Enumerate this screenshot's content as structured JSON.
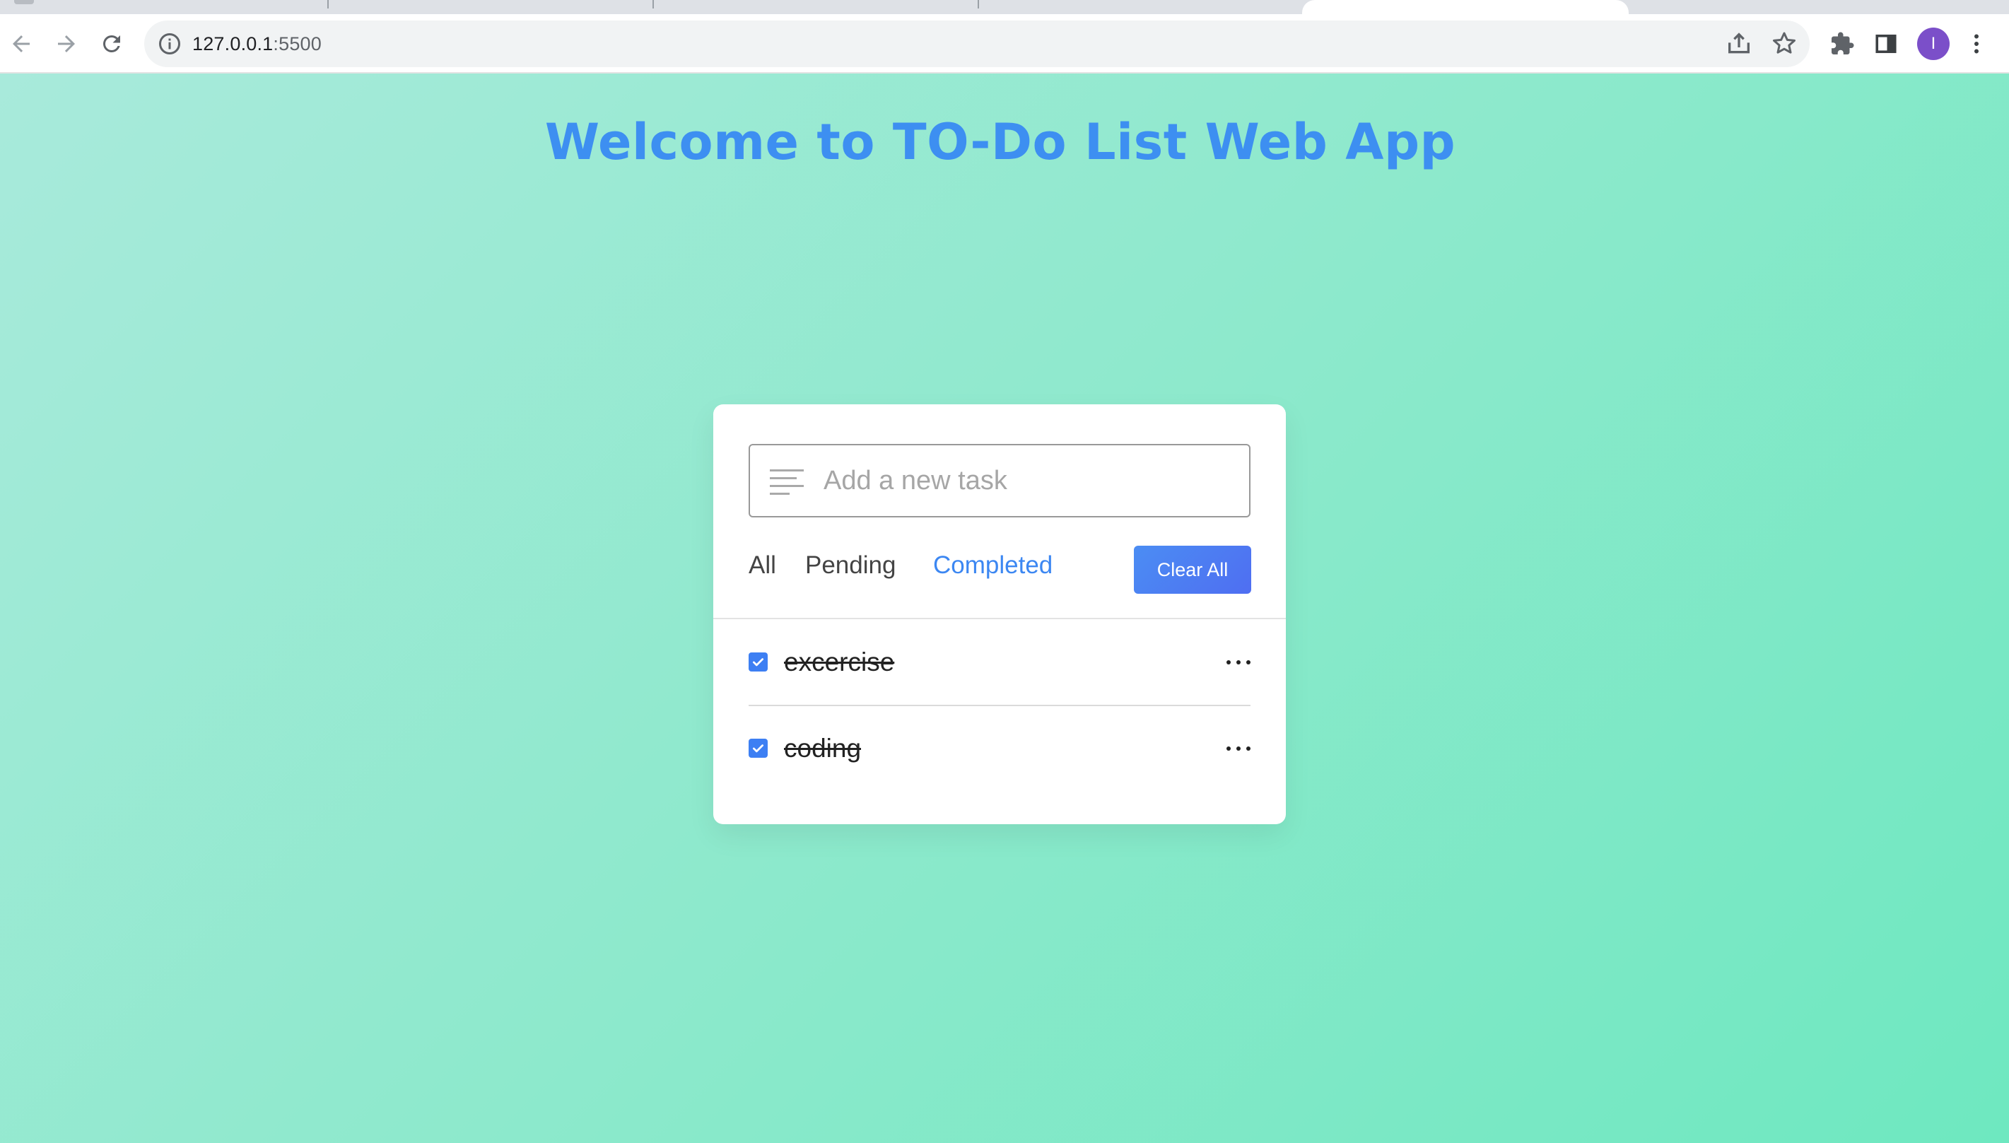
{
  "browser": {
    "url_host": "127.0.0.1",
    "url_port": ":5500",
    "profile_initial": "I",
    "icons": [
      "back-arrow-icon",
      "forward-arrow-icon",
      "reload-icon",
      "info-icon",
      "share-icon",
      "star-icon",
      "extensions-icon",
      "side-panel-icon",
      "kebab-menu-icon"
    ]
  },
  "page": {
    "title": "Welcome to TO-Do List Web App"
  },
  "todo": {
    "input_placeholder": "Add a new task",
    "input_value": "",
    "filters": [
      {
        "label": "All",
        "active": false
      },
      {
        "label": "Pending",
        "active": false
      },
      {
        "label": "Completed",
        "active": true
      }
    ],
    "clear_label": "Clear All",
    "tasks": [
      {
        "text": "excercise",
        "completed": true
      },
      {
        "text": "coding",
        "completed": true
      }
    ]
  },
  "colors": {
    "accent": "#3c87f2",
    "title": "#3d8ff1",
    "checkbox": "#3d7ff3",
    "background_start": "#a8eadb",
    "background_end": "#6ee8c0"
  }
}
